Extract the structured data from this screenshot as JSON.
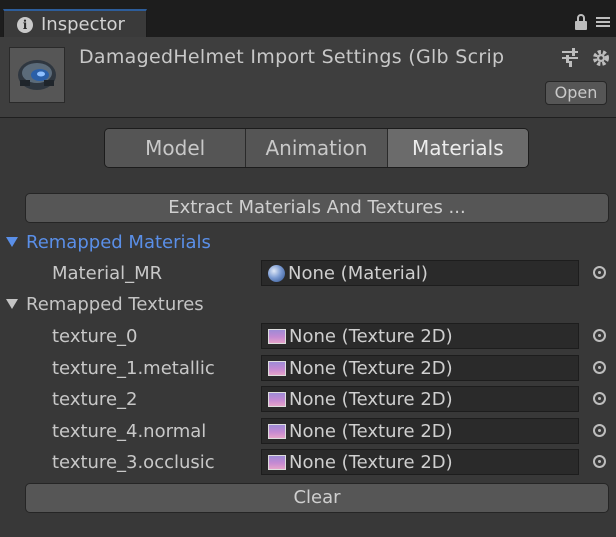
{
  "tab": {
    "label": "Inspector",
    "icon": "info-icon"
  },
  "header": {
    "title": "DamagedHelmet Import Settings (Glb Scrip",
    "open_label": "Open",
    "icons": [
      "preset-icon",
      "gear-icon"
    ]
  },
  "toolbar": {
    "tabs": [
      "Model",
      "Animation",
      "Materials"
    ],
    "selected": "Materials"
  },
  "extract_button": "Extract Materials And Textures ...",
  "remapped_materials": {
    "title": "Remapped Materials",
    "items": [
      {
        "label": "Material_MR",
        "value": "None (Material)"
      }
    ]
  },
  "remapped_textures": {
    "title": "Remapped Textures",
    "items": [
      {
        "label": "texture_0",
        "value": "None (Texture 2D)"
      },
      {
        "label": "texture_1.metallic",
        "value": "None (Texture 2D)"
      },
      {
        "label": "texture_2",
        "value": "None (Texture 2D)"
      },
      {
        "label": "texture_4.normal",
        "value": "None (Texture 2D)"
      },
      {
        "label": "texture_3.occlusic",
        "value": "None (Texture 2D)"
      }
    ]
  },
  "clear_button": "Clear",
  "colors": {
    "accent": "#5a8fe8",
    "panel": "#383838",
    "tab_highlight": "#2d5d9a"
  }
}
